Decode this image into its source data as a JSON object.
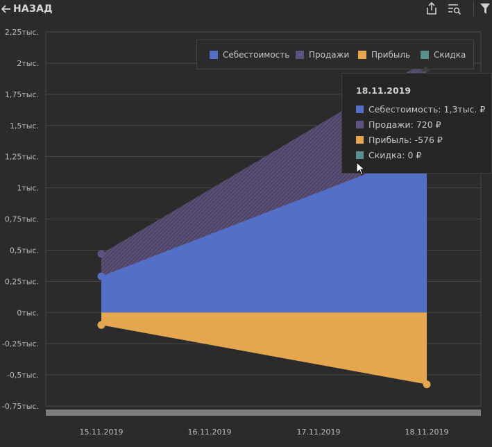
{
  "header": {
    "back_label": "НАЗАД",
    "icons": [
      "arrow-left-icon",
      "share-export-icon",
      "search-list-icon",
      "filter-icon"
    ]
  },
  "legend": {
    "items": [
      {
        "label": "Себестоимость",
        "color": "#5470c6"
      },
      {
        "label": "Продажи",
        "color": "#5f5283"
      },
      {
        "label": "Прибыль",
        "color": "#e4a64f"
      },
      {
        "label": "Скидка",
        "color": "#5a8f8f"
      }
    ]
  },
  "tooltip": {
    "date": "18.11.2019",
    "rows": [
      {
        "text": "Себестоимость: 1,3тыс. ₽",
        "color": "#5470c6"
      },
      {
        "text": "Продажи: 720 ₽",
        "color": "#5f5283"
      },
      {
        "text": "Прибыль: -576 ₽",
        "color": "#e4a64f"
      },
      {
        "text": "Скидка: 0 ₽",
        "color": "#5a8f8f"
      }
    ]
  },
  "chart_data": {
    "type": "area",
    "categories": [
      "15.11.2019",
      "16.11.2019",
      "17.11.2019",
      "18.11.2019"
    ],
    "series": [
      {
        "name": "Себестоимость",
        "color": "#5470c6",
        "points": [
          [
            "15.11.2019",
            290
          ],
          [
            "18.11.2019",
            1300
          ]
        ]
      },
      {
        "name": "Продажи",
        "color": "#5f5283",
        "points": [
          [
            "15.11.2019",
            470
          ],
          [
            "18.11.2019",
            2020
          ]
        ]
      },
      {
        "name": "Прибыль",
        "color": "#e4a64f",
        "points": [
          [
            "15.11.2019",
            -100
          ],
          [
            "18.11.2019",
            -576
          ]
        ]
      },
      {
        "name": "Скидка",
        "color": "#5a8f8f",
        "points": [
          [
            "15.11.2019",
            0
          ],
          [
            "18.11.2019",
            0
          ]
        ]
      }
    ],
    "y_ticks": [
      {
        "value": 2250,
        "label": "2,25тыс."
      },
      {
        "value": 2000,
        "label": "2тыс."
      },
      {
        "value": 1750,
        "label": "1,75тыс."
      },
      {
        "value": 1500,
        "label": "1,5тыс."
      },
      {
        "value": 1250,
        "label": "1,25тыс."
      },
      {
        "value": 1000,
        "label": "1тыс."
      },
      {
        "value": 750,
        "label": "0,75тыс."
      },
      {
        "value": 500,
        "label": "0,5тыс."
      },
      {
        "value": 250,
        "label": "0,25тыс."
      },
      {
        "value": 0,
        "label": "0тыс."
      },
      {
        "value": -250,
        "label": "-0,25тыс."
      },
      {
        "value": -500,
        "label": "-0,5тыс."
      },
      {
        "value": -750,
        "label": "-0,75тыс."
      }
    ],
    "ylim": [
      -750,
      2250
    ],
    "grid": true
  }
}
